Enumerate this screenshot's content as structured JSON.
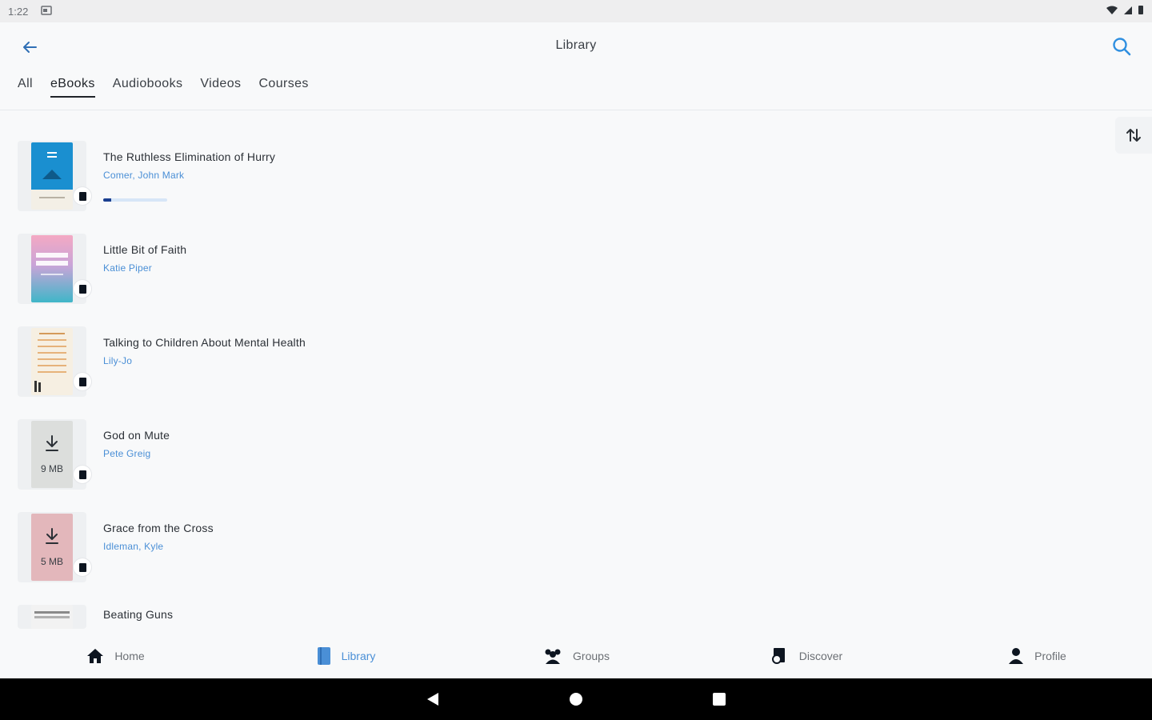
{
  "status_bar": {
    "time": "1:22"
  },
  "header": {
    "title": "Library",
    "back_icon": "arrow-left-icon",
    "search_icon": "search-icon"
  },
  "tabs": [
    {
      "label": "All",
      "active": false
    },
    {
      "label": "eBooks",
      "active": true
    },
    {
      "label": "Audiobooks",
      "active": false
    },
    {
      "label": "Videos",
      "active": false
    },
    {
      "label": "Courses",
      "active": false
    }
  ],
  "sort_icon": "sort-arrows-icon",
  "books": [
    {
      "title": "The Ruthless Elimination of Hurry",
      "author": "Comer, John Mark",
      "progress_percent": 12,
      "cover_color": "#1a8fd0"
    },
    {
      "title": "Little Bit of Faith",
      "author": "Katie Piper",
      "cover_color": "#3fb6c8"
    },
    {
      "title": "Talking to Children About Mental Health",
      "author": "Lily-Jo",
      "cover_color": "#f6efe2"
    },
    {
      "title": "God on Mute",
      "author": "Pete Greig",
      "download_size": "9 MB",
      "cover_color": "#dcdedc"
    },
    {
      "title": "Grace from the Cross",
      "author": "Idleman, Kyle",
      "download_size": "5 MB",
      "cover_color": "#e3b7bb"
    },
    {
      "title": "Beating Guns",
      "author": "",
      "cover_color": "#f2f2f2"
    }
  ],
  "bottom_nav": [
    {
      "label": "Home",
      "icon": "home-icon",
      "active": false
    },
    {
      "label": "Library",
      "icon": "library-book-icon",
      "active": true
    },
    {
      "label": "Groups",
      "icon": "groups-icon",
      "active": false
    },
    {
      "label": "Discover",
      "icon": "discover-icon",
      "active": false
    },
    {
      "label": "Profile",
      "icon": "profile-icon",
      "active": false
    }
  ],
  "colors": {
    "accent": "#4a8fd6",
    "progress_fill": "#1a3f8f"
  }
}
